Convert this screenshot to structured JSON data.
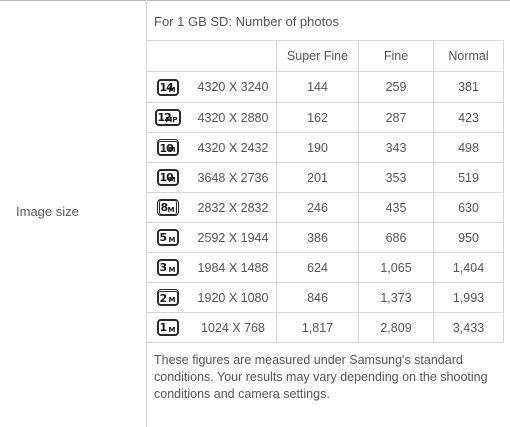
{
  "row_label": "Image size",
  "heading": "For 1 GB SD: Number of photos",
  "columns": [
    "Super Fine",
    "Fine",
    "Normal"
  ],
  "rows": [
    {
      "icon": "14M",
      "icon_name": "14m-size-icon",
      "resolution": "4320 X 3240",
      "super_fine": "144",
      "fine": "259",
      "normal": "381"
    },
    {
      "icon": "12MP",
      "icon_name": "12mp-size-icon",
      "resolution": "4320 X 2880",
      "super_fine": "162",
      "fine": "287",
      "normal": "423"
    },
    {
      "icon": "10M",
      "icon_name": "10m-wide-size-icon",
      "resolution": "4320 X 2432",
      "super_fine": "190",
      "fine": "343",
      "normal": "498"
    },
    {
      "icon": "10M",
      "icon_name": "10m-size-icon",
      "resolution": "3648 X 2736",
      "super_fine": "201",
      "fine": "353",
      "normal": "519"
    },
    {
      "icon": "8M",
      "icon_name": "8m-size-icon",
      "resolution": "2832 X 2832",
      "super_fine": "246",
      "fine": "435",
      "normal": "630"
    },
    {
      "icon": "5M",
      "icon_name": "5m-size-icon",
      "resolution": "2592 X 1944",
      "super_fine": "386",
      "fine": "686",
      "normal": "950"
    },
    {
      "icon": "3M",
      "icon_name": "3m-size-icon",
      "resolution": "1984 X 1488",
      "super_fine": "624",
      "fine": "1,065",
      "normal": "1,404"
    },
    {
      "icon": "2M",
      "icon_name": "2m-size-icon",
      "resolution": "1920 X 1080",
      "super_fine": "846",
      "fine": "1,373",
      "normal": "1,993"
    },
    {
      "icon": "1M",
      "icon_name": "1m-size-icon",
      "resolution": "1024 X 768",
      "super_fine": "1,817",
      "fine": "2,809",
      "normal": "3,433"
    }
  ],
  "note": "These figures are measured under Samsung's standard conditions. Your results may vary depending on the shooting conditions and camera settings."
}
